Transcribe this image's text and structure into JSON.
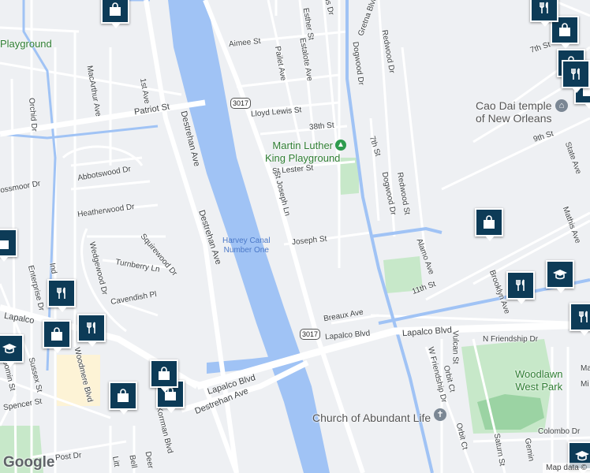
{
  "streets": {
    "aimee": "Aimee St",
    "patriot": "Patriot St",
    "lloyd_lewis": "Lloyd Lewis St",
    "s38th": "38th St",
    "lester": "St Lester St",
    "joseph": "Joseph St",
    "breaux": "Breaux Ave",
    "lapalco_w": "Lapalco Blvd",
    "lapalco_mid": "Lapalco Blvd",
    "lapalco_e": "Lapalco Blvd",
    "n_friendship": "N Friendship Dr",
    "w_friendship": "W Friendship Dr",
    "orbit_a": "Orbit Ct",
    "orbit_b": "Orbit Ct",
    "vulcan": "Vulcan St",
    "colombo": "Colombo Dr",
    "saturn": "Saturn St",
    "s11th": "11th St",
    "alamo": "Alamo Ave",
    "brooklyn": "Brooklyn Ave",
    "mathis": "Mathis Ave",
    "state": "State Ave",
    "s9th": "9th St",
    "s7th_a": "7th St",
    "s7th_b": "7th St",
    "redwood_a": "Redwood Dr",
    "redwood_b": "Redwood St",
    "dogwood_a": "Dogwood Dr",
    "dogwood_b": "Dogwood Dr",
    "gretna": "Gretna Blvd",
    "esther": "Esther St",
    "estalote": "Estalote Ave",
    "pailet": "Pailet Ave",
    "st_joseph_ln": "St Joseph Ln",
    "destrehan_a": "Destrehan Ave",
    "destrehan_b": "Destrehan Ave",
    "destrehan_c": "Destrehan Ave",
    "first": "1st Ave",
    "macarthur": "MacArthur Ave",
    "orchid": "Orchid Dr",
    "abbotswood": "Abbotswood Dr",
    "heatherwood": "Heatherwood Dr",
    "squirewood": "Squirewood Dr",
    "turnberry": "Turnberry Ln",
    "cavendish": "Cavendish Pl",
    "wedgewood": "Wedgewood Dr",
    "enterprise": "Enterprise Dr",
    "sussex": "Sussex St",
    "woodmere": "Woodmere Blvd",
    "spencer": "Spencer St",
    "post": "Post Dr",
    "korrman": "Korrman Blvd",
    "mossmoor": "ossmoor Dr",
    "lapalco_far_w": "Lapalco",
    "manhattan": "Ma",
    "mi": "Mi",
    "gemin": "Gemin",
    "bell": "Bell",
    "deer": "Deer",
    "litt": "Litt",
    "ind": "Ind",
    "laroom": "loomin St",
    "us_dr": "us Dr"
  },
  "shields": {
    "route_a": "3017",
    "route_b": "3017"
  },
  "water": {
    "canal": "Harvey Canal\nNumber One"
  },
  "parks": {
    "mlk": "Martin Luther\nKing Playground",
    "woodlawn": "Woodlawn\nWest Park",
    "playground_nw": "Playground"
  },
  "pois": {
    "cao_dai": "Cao Dai temple\nof New Orleans",
    "church": "Church of Abundant Life"
  },
  "icons": [
    "shopping-bag-icon",
    "restaurant-icon",
    "graduation-cap-icon",
    "place-of-worship-icon",
    "park-tree-icon"
  ],
  "colors": {
    "water": "#a0c3f5",
    "park": "#c7e8c9",
    "road": "#ffffff",
    "pin": "#0d3b57"
  },
  "attribution": {
    "logo": "Google",
    "data": "Map data ©"
  }
}
